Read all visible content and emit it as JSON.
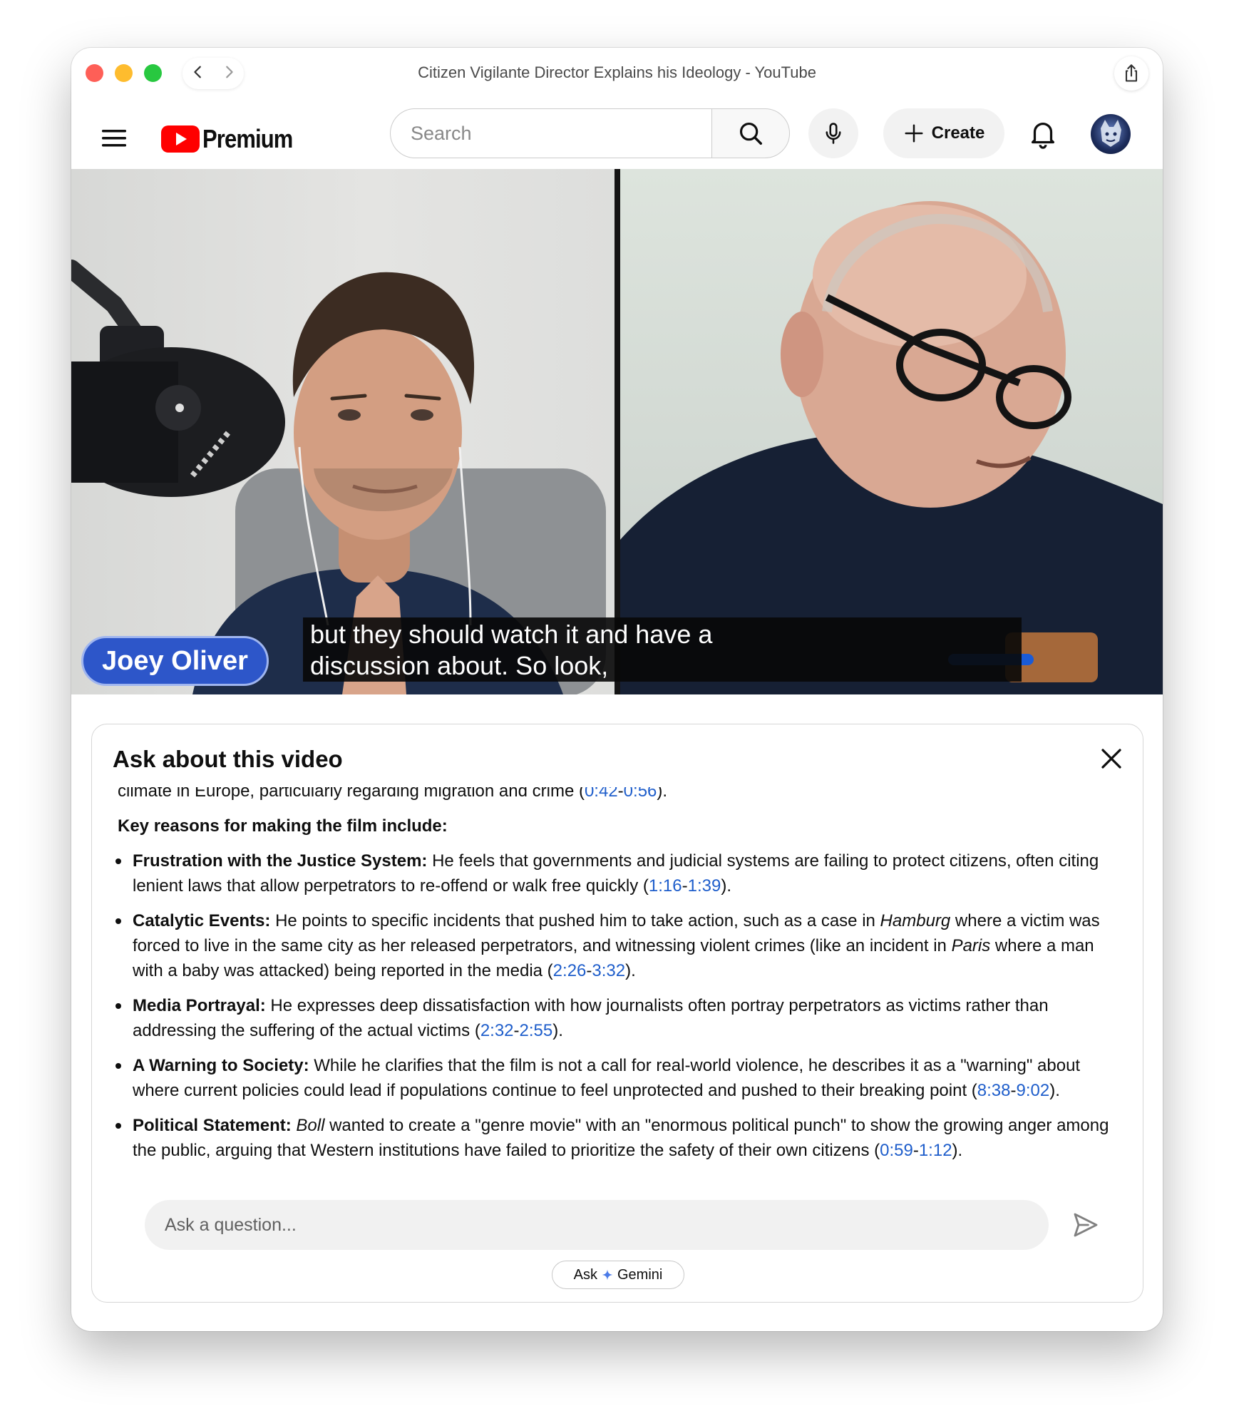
{
  "window": {
    "title": "Citizen Vigilante Director Explains his Ideology - YouTube"
  },
  "header": {
    "logo_text": "Premium",
    "search_placeholder": "Search",
    "create_label": "Create"
  },
  "video": {
    "speaker_name": "Joey Oliver",
    "caption_lines": [
      "but they should watch it and have a",
      "discussion about. So look,"
    ]
  },
  "ask_panel": {
    "title": "Ask about this video",
    "intro_fragment": "climate in Europe, particularly regarding migration and crime (",
    "intro_ts_start": "0:42",
    "intro_ts_end": "0:56",
    "intro_after": ").",
    "reasons_heading": "Key reasons for making the film include:",
    "items": [
      {
        "title": "Frustration with the Justice System:",
        "text": " He feels that governments and judicial systems are failing to protect citizens, often citing lenient laws that allow perpetrators to re-offend or walk free quickly (",
        "ts_start": "1:16",
        "ts_end": "1:39",
        "after": ")."
      },
      {
        "title": "Catalytic Events:",
        "text_1": " He points to specific incidents that pushed him to take action, such as a case in ",
        "em_1": "Hamburg",
        "text_2": " where a victim was forced to live in the same city as her released perpetrators, and witnessing violent crimes (like an incident in ",
        "em_2": "Paris",
        "text_3": " where a man with a baby was attacked) being reported in the media (",
        "ts_start": "2:26",
        "ts_end": "3:32",
        "after": ")."
      },
      {
        "title": "Media Portrayal:",
        "text": " He expresses deep dissatisfaction with how journalists often portray perpetrators as victims rather than addressing the suffering of the actual victims (",
        "ts_start": "2:32",
        "ts_end": "2:55",
        "after": ")."
      },
      {
        "title": "A Warning to Society:",
        "text": " While he clarifies that the film is not a call for real-world violence, he describes it as a \"warning\" about where current policies could lead if populations continue to feel unprotected and pushed to their breaking point (",
        "ts_start": "8:38",
        "ts_end": "9:02",
        "after": ")."
      },
      {
        "title": "Political Statement:",
        "em": "Boll",
        "text": " wanted to create a \"genre movie\" with an \"enormous political punch\" to show the growing anger among the public, arguing that Western institutions have failed to prioritize the safety of their own citizens (",
        "ts_start": "0:59",
        "ts_end": "1:12",
        "after": ")."
      }
    ],
    "ts_separator": "-",
    "input_placeholder": "Ask a question...",
    "gemini_ask": "Ask",
    "gemini_label": "Gemini"
  },
  "colors": {
    "youtube_red": "#ff0000",
    "timestamp_link": "#1f5ecb",
    "name_pill": "#2d56c9"
  },
  "icons": [
    "back-icon",
    "forward-icon",
    "share-icon",
    "menu-icon",
    "search-icon",
    "mic-icon",
    "plus-icon",
    "bell-icon",
    "close-icon",
    "send-icon",
    "gemini-sparkle-icon"
  ]
}
